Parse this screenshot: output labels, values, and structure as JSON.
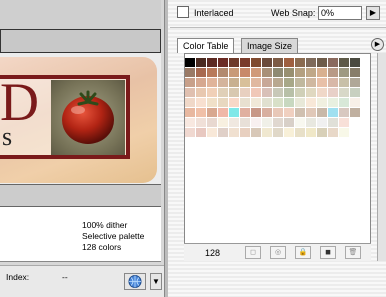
{
  "options": {
    "interlaced_label": "Interlaced",
    "websnap_label": "Web Snap:",
    "websnap_value": "0%"
  },
  "tabs": [
    {
      "label": "Color Table",
      "active": true
    },
    {
      "label": "Image Size",
      "active": false
    }
  ],
  "color_table": {
    "count": "128",
    "columns": 16,
    "swatches": [
      "#000000",
      "#4a2a20",
      "#5c2a22",
      "#6b2b24",
      "#6e3a2a",
      "#7a3b2b",
      "#804a2f",
      "#6a4a3a",
      "#7c5a44",
      "#9e5f3f",
      "#8a6b50",
      "#7e6a5a",
      "#6e5c4a",
      "#8a6a5e",
      "#5e5a48",
      "#4a4a40",
      "#9a7a66",
      "#a86a50",
      "#b87a5a",
      "#b38a6e",
      "#c89a78",
      "#c88a6a",
      "#d09a7a",
      "#a89078",
      "#8e8a72",
      "#989070",
      "#b4a080",
      "#c0a888",
      "#d8b090",
      "#b89a86",
      "#9e9a82",
      "#887e6a",
      "#c8a08a",
      "#d6a890",
      "#e0b49a",
      "#d4b49c",
      "#c8b090",
      "#d8c09a",
      "#e0b8a0",
      "#c8a898",
      "#b8a890",
      "#a8a888",
      "#c0b89e",
      "#d0b8a0",
      "#e8c0a8",
      "#d8b8a8",
      "#c8c0a8",
      "#b0a898",
      "#e0c0b0",
      "#e8c8b0",
      "#f0d0b8",
      "#e0d0b8",
      "#d8c8b0",
      "#e8d0c0",
      "#f0c8b8",
      "#d8c0b8",
      "#c8c8b8",
      "#b8c0a8",
      "#d0d0b8",
      "#e0d8c0",
      "#f0d8c8",
      "#e8d0c8",
      "#d8d8c8",
      "#c8d0c0",
      "#f0d8c8",
      "#f8e0d0",
      "#f0e0c8",
      "#e8d8c0",
      "#f8d8c8",
      "#e8e0d0",
      "#f0e8d8",
      "#e0e0d0",
      "#d8e0c8",
      "#c8d8c0",
      "#e8e8d8",
      "#f8e8d8",
      "#f0f0e0",
      "#e8f0e0",
      "#d8e8d8",
      "#f8f0e8",
      "#e8b8a0",
      "#f0c0a8",
      "#d8a890",
      "#f0b8a8",
      "#80e8e8",
      "#e0b0a0",
      "#c89888",
      "#d8b0a0",
      "#e8c8b8",
      "#f0d0c0",
      "#d0c0b0",
      "#e0c8b8",
      "#c8b8a8",
      "#a0e0f0",
      "#d8c8c0",
      "#c0b0a0",
      "#f8e8e0",
      "#f0e0d8",
      "#e8d8d0",
      "#f8f0e0",
      "#f0e8e0",
      "#e8e0d8",
      "#f8f0f0",
      "#f0f0e8",
      "#e0d8d0",
      "#d8d0c8",
      "#f8f8f0",
      "#e8e8e0",
      "#f0f0f0",
      "#e0e0d8",
      "#f8e0d8",
      "#ffffff",
      "#f0d8d0",
      "#e8c8c0",
      "#f8e8d8",
      "#e0d0c8",
      "#f0e0d0",
      "#e8d0c0",
      "#d8c8b8",
      "#f0e8d0",
      "#e0d8c8",
      "#f8f0d8",
      "#e8e0c8",
      "#f0e8c8",
      "#d8d0b8",
      "#e8d8c8",
      "#f8f8e8",
      "#ffffff"
    ]
  },
  "image_info": {
    "dither": "100% dither",
    "palette": "Selective palette",
    "colors": "128 colors"
  },
  "status": {
    "index_label": "Index:",
    "index_value": "--"
  },
  "image": {
    "big_letter": "D",
    "small_letter": "s"
  }
}
